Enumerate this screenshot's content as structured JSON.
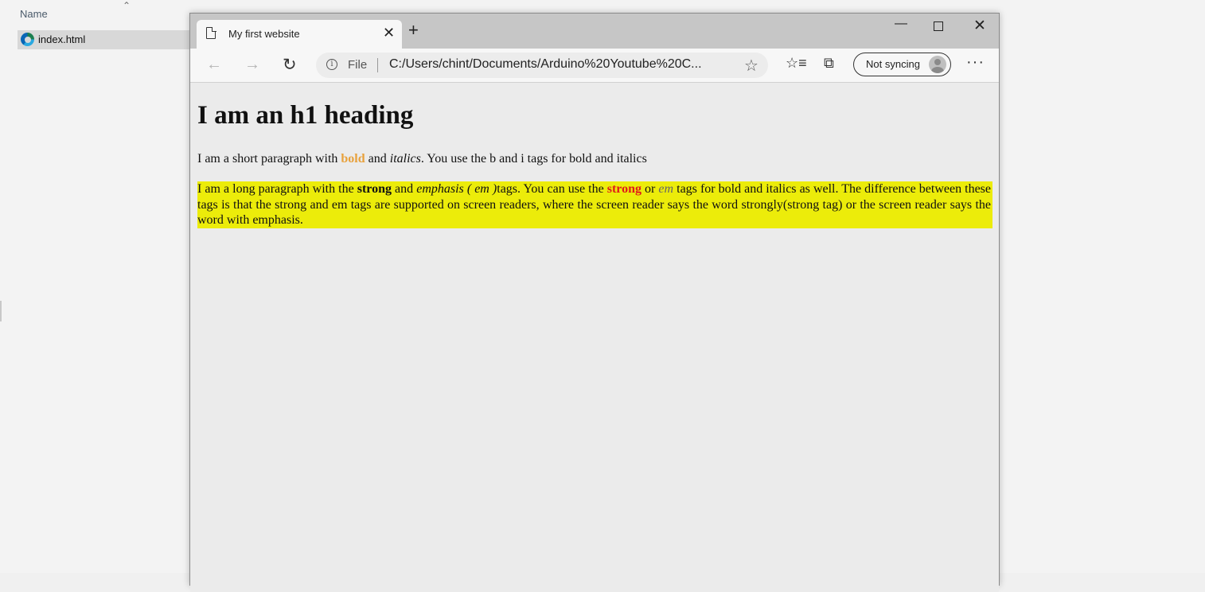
{
  "explorer": {
    "column_name": "Name",
    "file": {
      "name": "index.html"
    }
  },
  "browser": {
    "tab": {
      "title": "My first website"
    },
    "address": {
      "scheme": "File",
      "url": "C:/Users/chint/Documents/Arduino%20Youtube%20C..."
    },
    "sync_label": "Not syncing",
    "more_label": "···",
    "new_tab_label": "+"
  },
  "page": {
    "h1": "I am an h1 heading",
    "p1": {
      "t1": "I am a short paragraph with ",
      "bold": "bold",
      "t2": " and ",
      "italics": "italics",
      "t3": ". You use the b and i tags for bold and italics"
    },
    "p2": {
      "t1": "I am a long paragraph with the ",
      "strong1": "strong",
      "t2": " and ",
      "emphasis": "emphasis ( em )",
      "t3": "tags. You can use the ",
      "strong2": "strong",
      "t4": " or ",
      "em2": "em",
      "t5": " tags for bold and italics as well. The difference between these tags is that the strong and em tags are supported on screen readers, where the screen reader says the word strongly(strong tag) or the screen reader says the word with emphasis."
    }
  }
}
